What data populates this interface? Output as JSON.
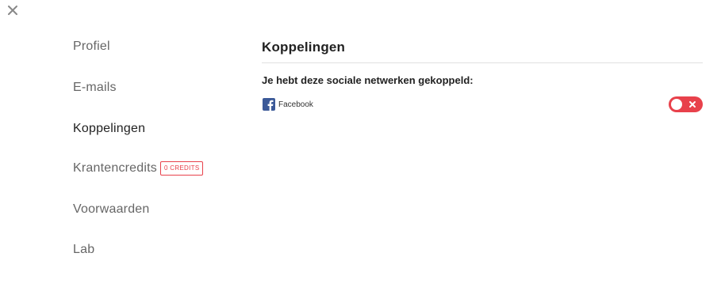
{
  "close": {
    "icon": "close-icon"
  },
  "sidebar": {
    "items": [
      {
        "label": "Profiel",
        "active": false
      },
      {
        "label": "E-mails",
        "active": false
      },
      {
        "label": "Koppelingen",
        "active": true
      },
      {
        "label": "Krantencredits",
        "active": false,
        "badge": "0 CREDITS"
      },
      {
        "label": "Voorwaarden",
        "active": false
      },
      {
        "label": "Lab",
        "active": false
      }
    ]
  },
  "main": {
    "title": "Koppelingen",
    "subtitle": "Je hebt deze sociale netwerken gekoppeld:",
    "accounts": [
      {
        "icon": "facebook-icon",
        "name": "Facebook",
        "connected": true
      }
    ]
  },
  "colors": {
    "accent": "#e8414b",
    "facebook": "#3b5998",
    "divider": "#e1e1e1"
  }
}
